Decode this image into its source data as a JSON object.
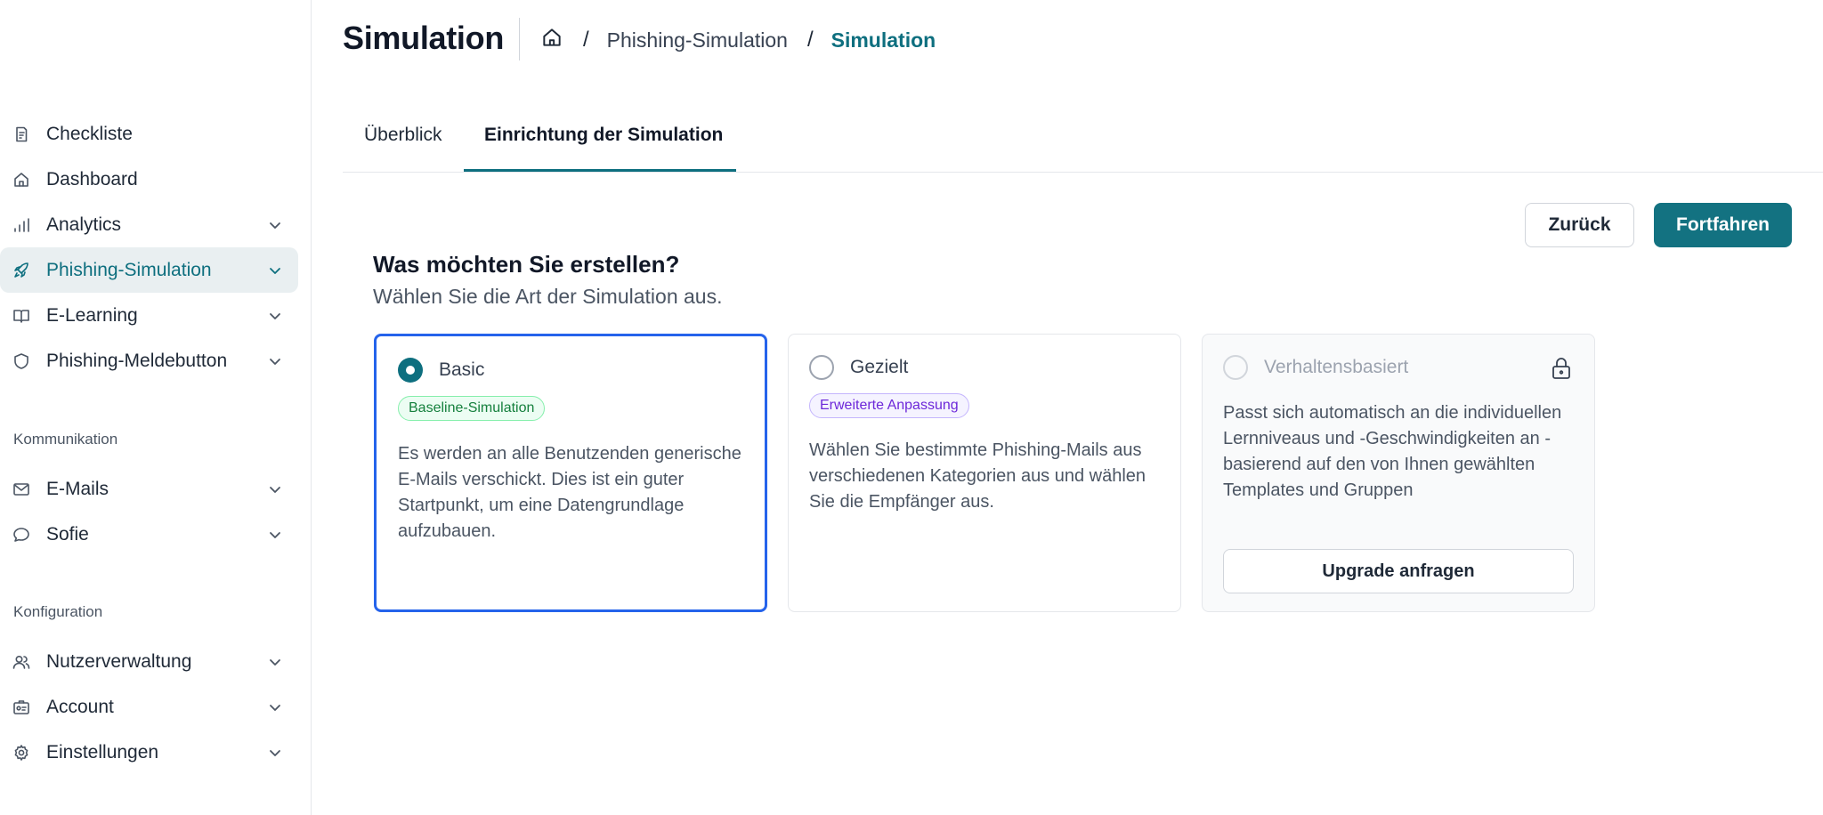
{
  "header": {
    "title": "Simulation",
    "breadcrumb": [
      "Phishing-Simulation",
      "Simulation"
    ]
  },
  "tabs": [
    {
      "label": "Überblick"
    },
    {
      "label": "Einrichtung der Simulation",
      "active": true
    }
  ],
  "actions": {
    "back_label": "Zurück",
    "continue_label": "Fortfahren"
  },
  "sidebar": {
    "items": [
      {
        "label": "Checkliste",
        "icon": "checklist-icon"
      },
      {
        "label": "Dashboard",
        "icon": "home-icon"
      },
      {
        "label": "Analytics",
        "icon": "bar-chart-icon"
      },
      {
        "label": "Phishing-Simulation",
        "icon": "rocket-icon",
        "active": true
      },
      {
        "label": "E-Learning",
        "icon": "book-icon"
      },
      {
        "label": "Phishing-Meldebutton",
        "icon": "shield-icon"
      }
    ],
    "sections": [
      {
        "label": "Kommunikation",
        "items": [
          {
            "label": "E-Mails",
            "icon": "mail-icon"
          },
          {
            "label": "Sofie",
            "icon": "chat-bubble-icon"
          }
        ]
      },
      {
        "label": "Konfiguration",
        "items": [
          {
            "label": "Nutzerverwaltung",
            "icon": "users-icon"
          },
          {
            "label": "Account",
            "icon": "id-card-icon"
          },
          {
            "label": "Einstellungen",
            "icon": "gear-icon"
          }
        ]
      }
    ]
  },
  "content": {
    "question": "Was möchten Sie erstellen?",
    "subtitle": "Wählen Sie die Art der Simulation aus.",
    "options": [
      {
        "title": "Basic",
        "badge": "Baseline-Simulation",
        "description": "Es werden an alle Benutzenden generische E-Mails verschickt. Dies ist ein guter Startpunkt, um eine Datengrundlage aufzubauen.",
        "selected": true
      },
      {
        "title": "Gezielt",
        "badge": "Erweiterte Anpassung",
        "description": "Wählen Sie bestimmte Phishing-Mails aus verschiedenen Kategorien aus und wählen Sie die Empfänger aus.",
        "selected": false
      },
      {
        "title": "Verhaltensbasiert",
        "description": "Passt sich automatisch an die individuellen Lernniveaus und -Geschwindigkeiten an - basierend auf den von Ihnen gewählten Templates und Gruppen",
        "button_label": "Upgrade anfragen",
        "locked": true
      }
    ]
  },
  "colors": {
    "accent": "#0e6f7f",
    "primary_button": "#137281",
    "selected_border": "#2563eb",
    "active_nav_bg": "#e9eff1"
  }
}
